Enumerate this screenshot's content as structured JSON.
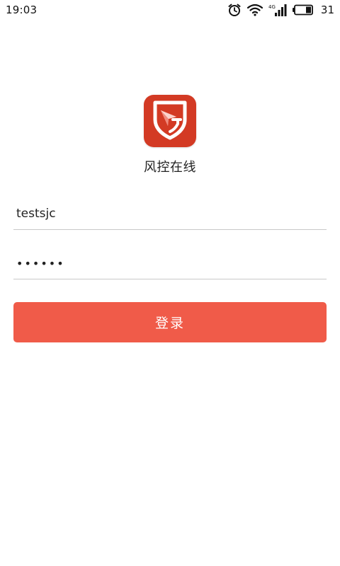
{
  "status_bar": {
    "time": "19:03",
    "network_type": "4G",
    "battery_level": "31",
    "icons": [
      "alarm-icon",
      "wifi-icon",
      "signal-icon",
      "battery-icon"
    ]
  },
  "app": {
    "name": "风控在线",
    "logo_icon": "shield-g-logo-icon",
    "brand_color": "#d33a24"
  },
  "login_form": {
    "username_value": "testsjc",
    "password_value": "••••••",
    "submit_label": "登录",
    "button_color": "#f05b49"
  }
}
